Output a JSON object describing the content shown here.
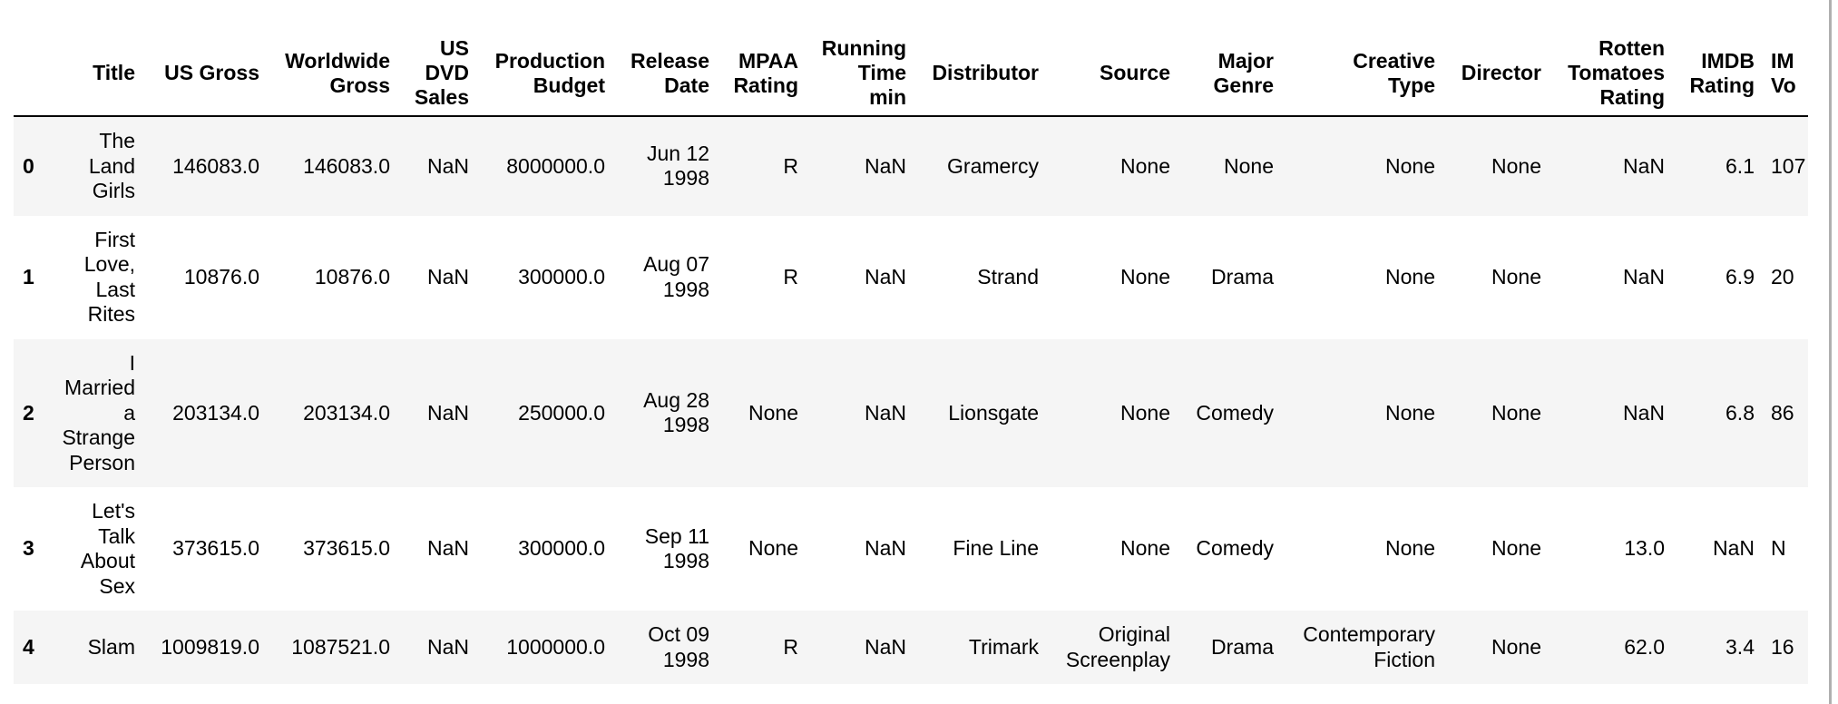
{
  "columns": [
    "",
    "Title",
    "US Gross",
    "Worldwide\nGross",
    "US\nDVD\nSales",
    "Production\nBudget",
    "Release\nDate",
    "MPAA\nRating",
    "Running\nTime\nmin",
    "Distributor",
    "Source",
    "Major\nGenre",
    "Creative\nType",
    "Director",
    "Rotten\nTomatoes\nRating",
    "IMDB\nRating",
    "IM\nVo"
  ],
  "rows": [
    [
      "0",
      "The Land Girls",
      "146083.0",
      "146083.0",
      "NaN",
      "8000000.0",
      "Jun 12 1998",
      "R",
      "NaN",
      "Gramercy",
      "None",
      "None",
      "None",
      "None",
      "NaN",
      "6.1",
      "107"
    ],
    [
      "1",
      "First Love, Last Rites",
      "10876.0",
      "10876.0",
      "NaN",
      "300000.0",
      "Aug 07 1998",
      "R",
      "NaN",
      "Strand",
      "None",
      "Drama",
      "None",
      "None",
      "NaN",
      "6.9",
      "20"
    ],
    [
      "2",
      "I Married a Strange Person",
      "203134.0",
      "203134.0",
      "NaN",
      "250000.0",
      "Aug 28 1998",
      "None",
      "NaN",
      "Lionsgate",
      "None",
      "Comedy",
      "None",
      "None",
      "NaN",
      "6.8",
      "86"
    ],
    [
      "3",
      "Let's Talk About Sex",
      "373615.0",
      "373615.0",
      "NaN",
      "300000.0",
      "Sep 11 1998",
      "None",
      "NaN",
      "Fine Line",
      "None",
      "Comedy",
      "None",
      "None",
      "13.0",
      "NaN",
      "N"
    ],
    [
      "4",
      "Slam",
      "1009819.0",
      "1087521.0",
      "NaN",
      "1000000.0",
      "Oct 09 1998",
      "R",
      "NaN",
      "Trimark",
      "Original Screenplay",
      "Drama",
      "Contemporary Fiction",
      "None",
      "62.0",
      "3.4",
      "16"
    ]
  ],
  "colors": {
    "stripe": "#f5f5f5",
    "header_rule": "#000000"
  }
}
